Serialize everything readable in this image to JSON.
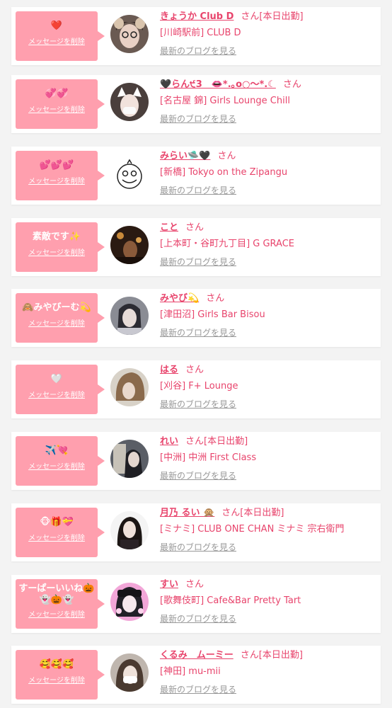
{
  "delete_label": "メッセージを削除",
  "blog_label": "最新のブログを見る",
  "honorific": "さん",
  "colors": {
    "accent": "#e8446c",
    "bubble": "#ff9fae",
    "muted": "#999999"
  },
  "rows": [
    {
      "message": "❤️",
      "name": "きょうか Club D",
      "status": "[本日出勤]",
      "shop": "[川崎駅前] CLUB D"
    },
    {
      "message": "💞💞",
      "name": "🖤らん੯3　👄*.｡o○～*.☾",
      "status": "",
      "shop": "[名古屋 錦] Girls Lounge Chill"
    },
    {
      "message": "💕💕💕",
      "name": "みらい🛸🖤",
      "status": "",
      "shop": "[新橋] Tokyo on the Zipangu"
    },
    {
      "message": "素敵です✨",
      "name": "こと",
      "status": "",
      "shop": "[上本町・谷町九丁目] G GRACE"
    },
    {
      "message": "🙈みやびーむ💫",
      "name": "みやび💫",
      "status": "",
      "shop": "[津田沼] Girls Bar Bisou"
    },
    {
      "message": "🤍",
      "name": "はる",
      "status": "",
      "shop": "[刈谷] F+ Lounge"
    },
    {
      "message": "✈️💘",
      "name": "れい",
      "status": "[本日出勤]",
      "shop": "[中洲] 中洲 First Class"
    },
    {
      "message": "🐵🎁💝",
      "name": "月乃 るい 🙊",
      "status": "[本日出勤]",
      "shop": "[ミナミ] CLUB ONE CHAN ミナミ 宗右衛門"
    },
    {
      "message": "すーぱーいいね🎃\n👻🎃👻",
      "name": "すい",
      "status": "",
      "shop": "[歌舞伎町] Cafe&Bar Pretty Tart"
    },
    {
      "message": "🥰🥰🥰",
      "name": "くるみ　ムーミー",
      "status": "[本日出勤]",
      "shop": "[神田] mu-mii"
    }
  ]
}
